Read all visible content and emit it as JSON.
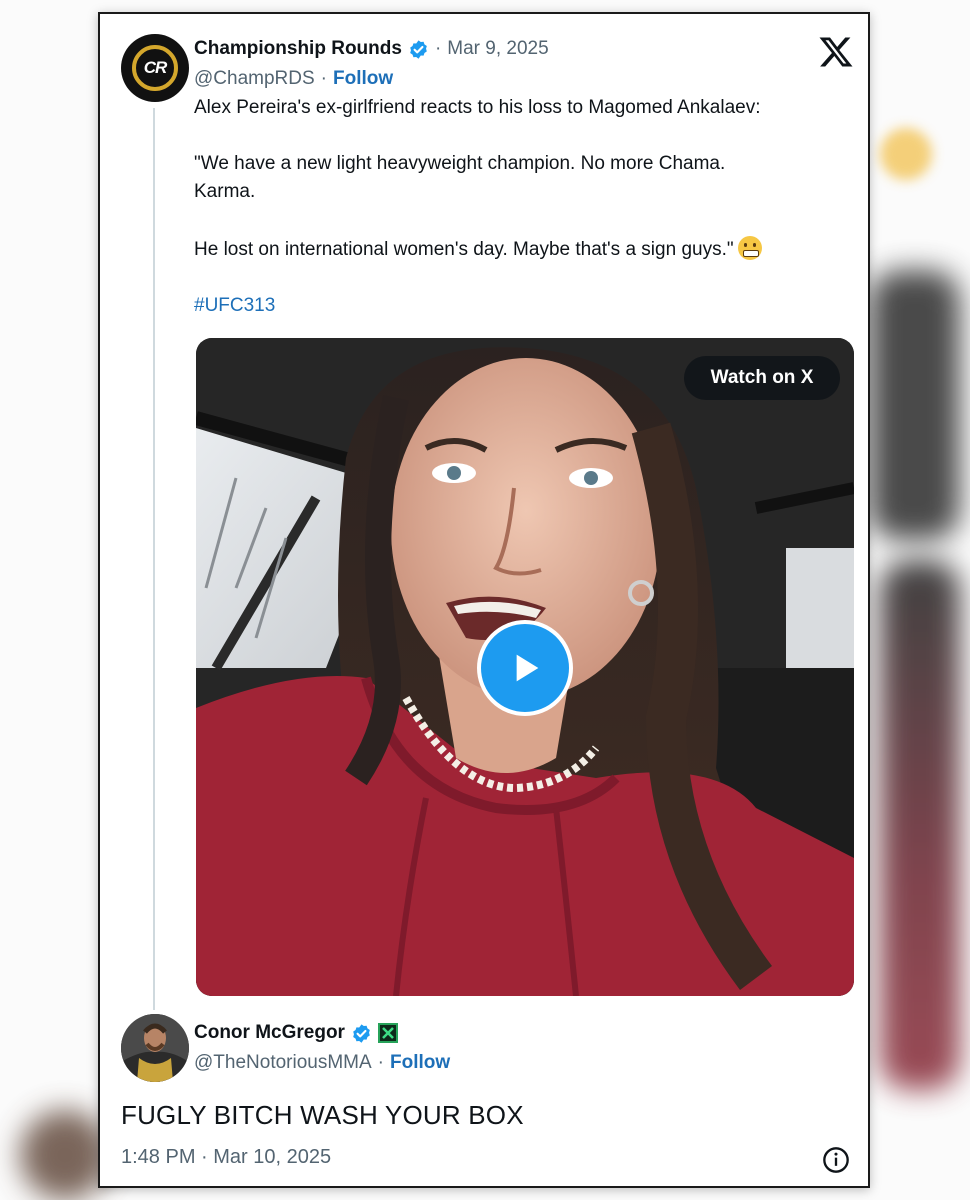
{
  "tweet": {
    "author_name": "Championship Rounds",
    "author_handle": "@ChampRDS",
    "avatar_text": "CR",
    "date": "Mar 9, 2025",
    "separator": "·",
    "follow_label": "Follow",
    "lines": [
      "Alex Pereira's ex-girlfriend reacts to his loss to Magomed Ankalaev:",
      "\"We have a new light heavyweight champion. No more Chama.",
      "Karma.",
      "He lost on international women's day. Maybe that's a sign guys.\""
    ],
    "hashtag": "#UFC313",
    "media": {
      "watch_label": "Watch on X",
      "progress": 0
    }
  },
  "reply": {
    "author_name": "Conor McGregor",
    "author_handle": "@TheNotoriousMMA",
    "separator": "·",
    "follow_label": "Follow",
    "text": "FUGLY BITCH WASH YOUR BOX",
    "timestamp": "1:48 PM · Mar 10, 2025"
  },
  "colors": {
    "accent": "#1d9bf0",
    "link": "#1d6fb8",
    "muted": "#536471",
    "text": "#0f1419"
  },
  "icons": [
    "x-logo-icon",
    "verified-badge-icon",
    "play-icon",
    "info-icon",
    "grinning-emoji-icon",
    "affiliate-badge-icon"
  ]
}
